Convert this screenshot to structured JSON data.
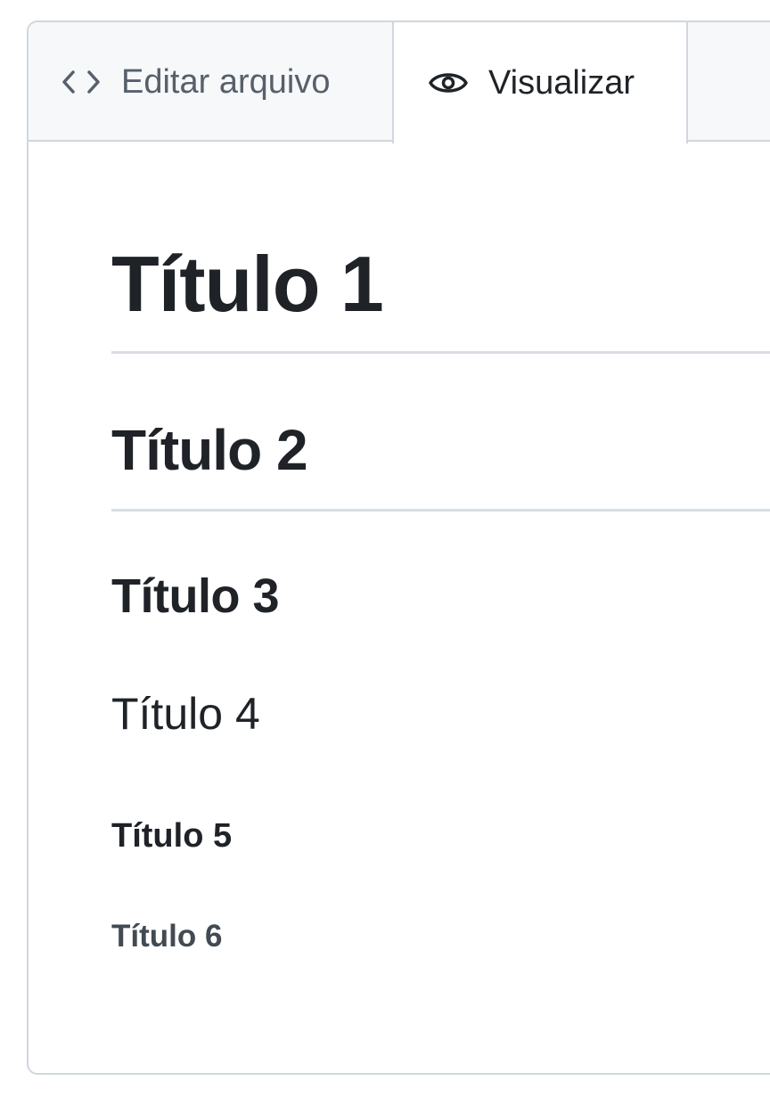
{
  "tabs": {
    "edit": {
      "label": "Editar arquivo",
      "icon": "code-icon"
    },
    "preview": {
      "label": "Visualizar",
      "icon": "eye-icon",
      "active": true
    }
  },
  "preview": {
    "h1": "Título 1",
    "h2": "Título 2",
    "h3": "Título 3",
    "h4": "Título 4",
    "h5": "Título 5",
    "h6": "Título 6"
  },
  "colors": {
    "text": "#1f2328",
    "muted": "#57606a",
    "border": "#d0d7de",
    "tabbar_bg": "#f6f8fa"
  }
}
